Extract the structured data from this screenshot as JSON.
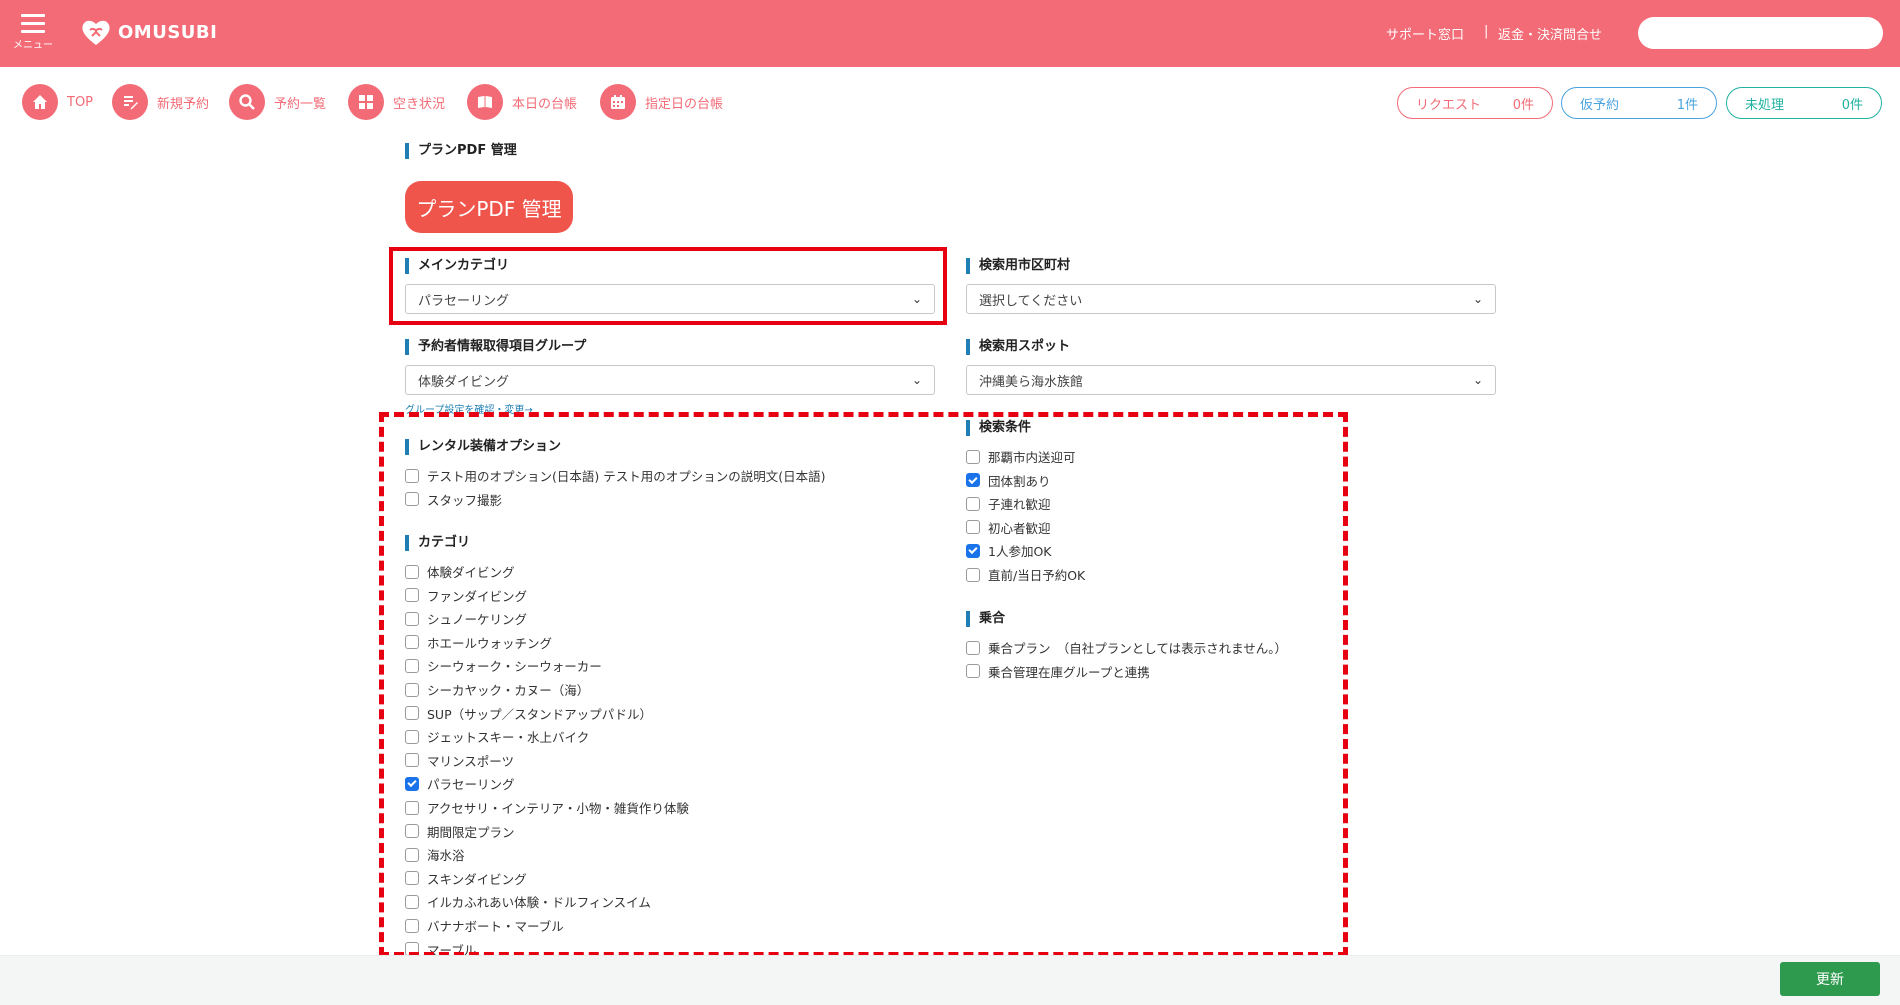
{
  "header": {
    "menu_label": "メニュー",
    "brand": "OMUSUBI",
    "support_link": "サポート窓口",
    "separator": "|",
    "refund_link": "返金・決済問合せ",
    "search_placeholder": "",
    "bg_color": "#f26b76"
  },
  "nav": {
    "items": [
      {
        "label": "TOP",
        "icon": "home-icon"
      },
      {
        "label": "新規予約",
        "icon": "new-booking-icon"
      },
      {
        "label": "予約一覧",
        "icon": "search-icon"
      },
      {
        "label": "空き状況",
        "icon": "grid-icon"
      },
      {
        "label": "本日の台帳",
        "icon": "book-icon"
      },
      {
        "label": "指定日の台帳",
        "icon": "calendar-icon"
      }
    ],
    "status": [
      {
        "label": "リクエスト",
        "count": "0件",
        "color": "#f26b76"
      },
      {
        "label": "仮予約",
        "count": "1件",
        "color": "#4aa3df"
      },
      {
        "label": "未処理",
        "count": "0件",
        "color": "#20b2a0"
      }
    ]
  },
  "page": {
    "section_title": "プランPDF 管理",
    "pdf_button": "プランPDF 管理",
    "main_category": {
      "label": "メインカテゴリ",
      "value": "パラセーリング"
    },
    "search_city": {
      "label": "検索用市区町村",
      "value": "選択してください"
    },
    "booker_group": {
      "label": "予約者情報取得項目グループ",
      "value": "体験ダイビング"
    },
    "search_spot": {
      "label": "検索用スポット",
      "value": "沖縄美ら海水族館"
    },
    "group_link": "グループ設定を確認・変更→"
  },
  "rental": {
    "title": "レンタル装備オプション",
    "items": [
      {
        "label": "テスト用のオプション(日本語) テスト用のオプションの説明文(日本語)",
        "checked": false
      },
      {
        "label": "スタッフ撮影",
        "checked": false
      }
    ]
  },
  "category": {
    "title": "カテゴリ",
    "items": [
      {
        "label": "体験ダイビング",
        "checked": false
      },
      {
        "label": "ファンダイビング",
        "checked": false
      },
      {
        "label": "シュノーケリング",
        "checked": false
      },
      {
        "label": "ホエールウォッチング",
        "checked": false
      },
      {
        "label": "シーウォーク・シーウォーカー",
        "checked": false
      },
      {
        "label": "シーカヤック・カヌー（海）",
        "checked": false
      },
      {
        "label": "SUP（サップ／スタンドアップパドル）",
        "checked": false
      },
      {
        "label": "ジェットスキー・水上バイク",
        "checked": false
      },
      {
        "label": "マリンスポーツ",
        "checked": false
      },
      {
        "label": "パラセーリング",
        "checked": true
      },
      {
        "label": "アクセサリ・インテリア・小物・雑貨作り体験",
        "checked": false
      },
      {
        "label": "期間限定プラン",
        "checked": false
      },
      {
        "label": "海水浴",
        "checked": false
      },
      {
        "label": "スキンダイビング",
        "checked": false
      },
      {
        "label": "イルカふれあい体験・ドルフィンスイム",
        "checked": false
      },
      {
        "label": "バナナボート・マーブル",
        "checked": false
      },
      {
        "label": "マーブル",
        "checked": false
      }
    ]
  },
  "search_conditions": {
    "title": "検索条件",
    "items": [
      {
        "label": "那覇市内送迎可",
        "checked": false
      },
      {
        "label": "団体割あり",
        "checked": true
      },
      {
        "label": "子連れ歓迎",
        "checked": false
      },
      {
        "label": "初心者歓迎",
        "checked": false
      },
      {
        "label": "1人参加OK",
        "checked": true
      },
      {
        "label": "直前/当日予約OK",
        "checked": false
      }
    ]
  },
  "ride_share": {
    "title": "乗合",
    "items": [
      {
        "label": "乗合プラン　（自社プランとしては表示されません。）",
        "checked": false
      },
      {
        "label": "乗合管理在庫グループと連携",
        "checked": false
      }
    ]
  },
  "footer": {
    "update_button": "更新"
  }
}
